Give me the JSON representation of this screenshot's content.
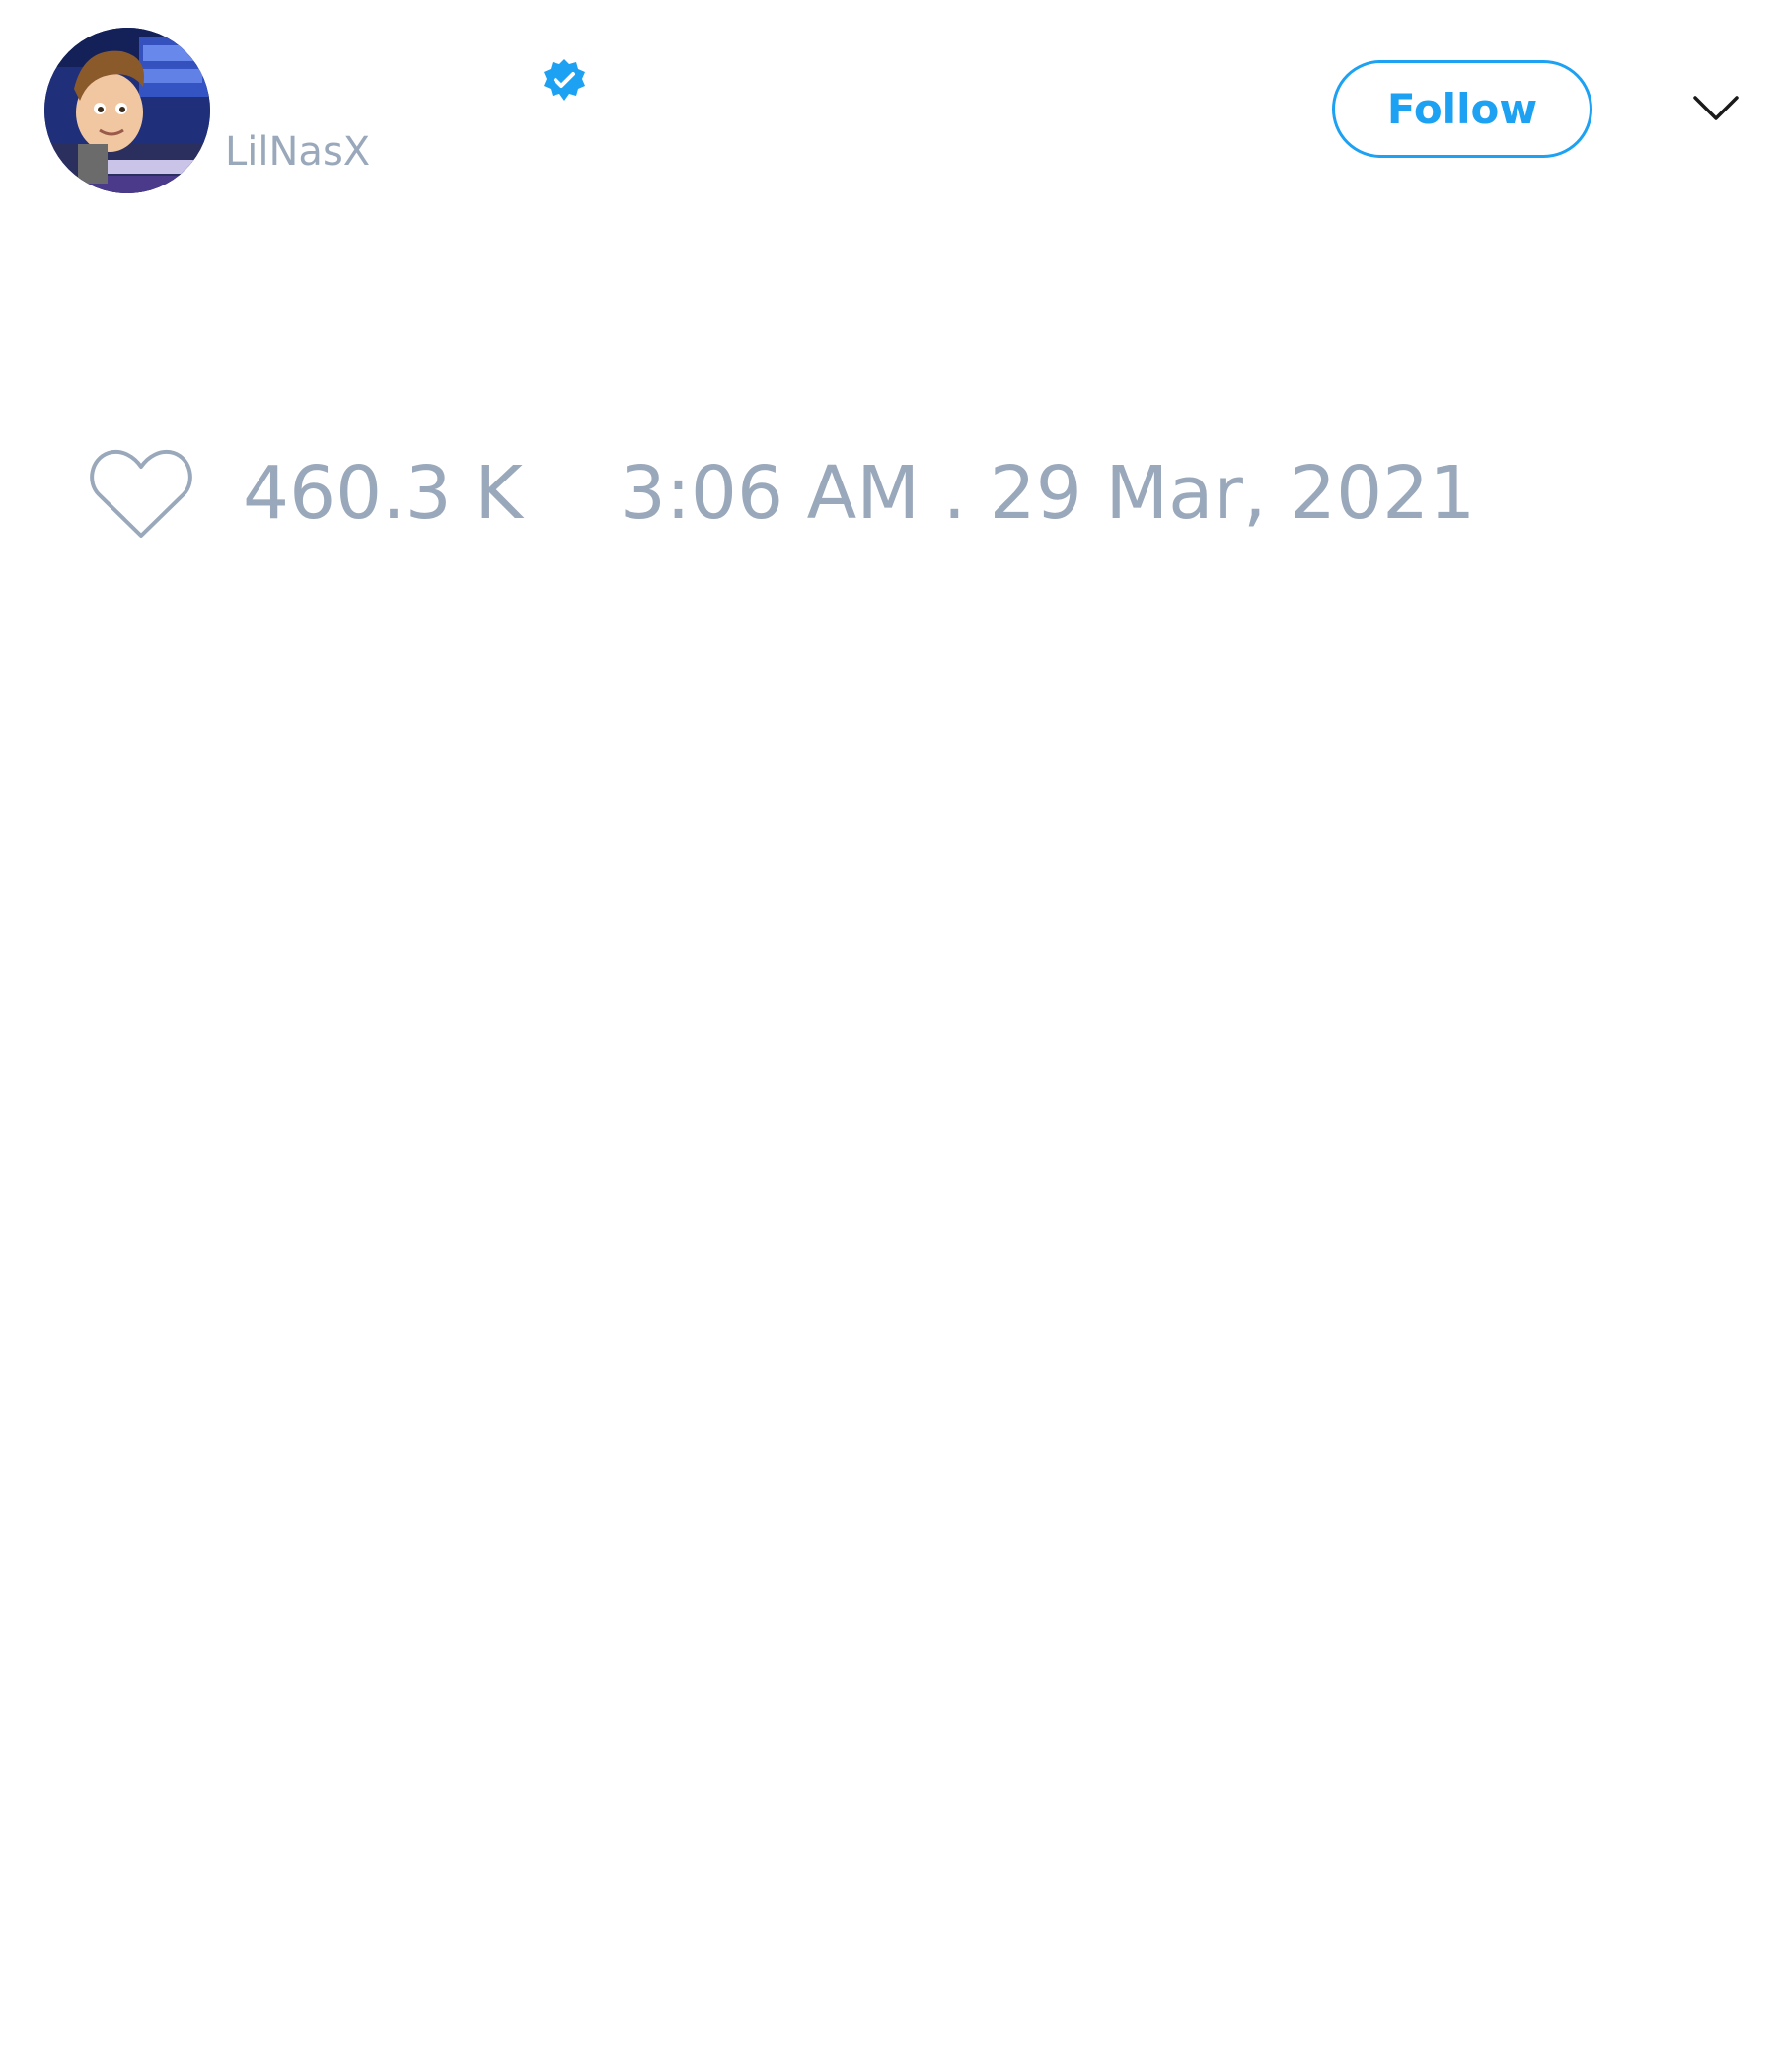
{
  "author": {
    "handle": "LilNasX",
    "verified": true,
    "avatar_icon": "avatar-cartoon-boy-infowars"
  },
  "header": {
    "follow_label": "Follow",
    "menu_icon": "chevron-down-icon"
  },
  "stats": {
    "like_icon": "heart-outline-icon",
    "likes": "460.3 K",
    "timestamp": "3:06 AM . 29 Mar, 2021"
  },
  "colors": {
    "accent": "#1da1f2",
    "muted_text": "#9aa8bb",
    "background": "#ffffff"
  }
}
